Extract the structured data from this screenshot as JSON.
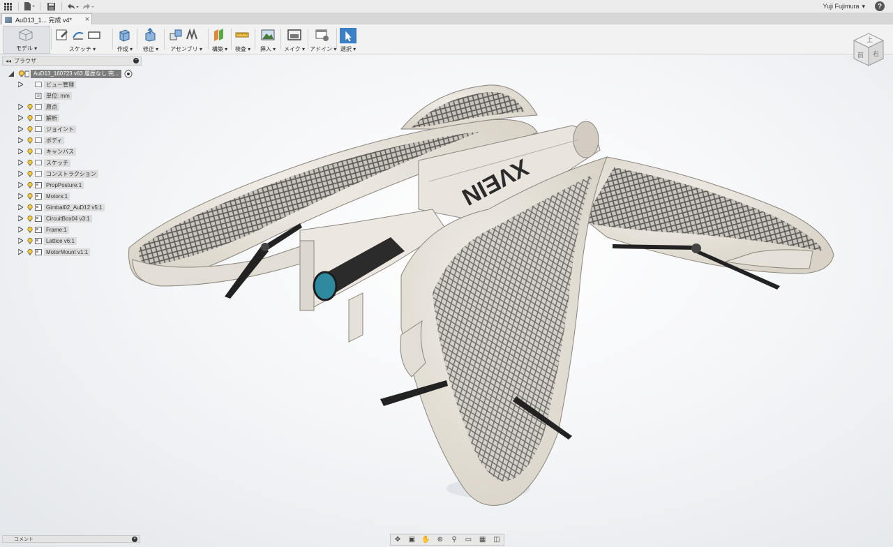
{
  "topbar": {
    "user_name": "Yuji Fujimura",
    "user_caret": "▾",
    "help_label": "?"
  },
  "tab": {
    "title": "AuD13_1...  完成 v4*",
    "close": "×"
  },
  "ribbon": {
    "workspace_label": "モデル ▾",
    "groups": [
      {
        "label": "スケッチ ▾"
      },
      {
        "label": "作成 ▾"
      },
      {
        "label": "修正 ▾"
      },
      {
        "label": "アセンブリ ▾"
      },
      {
        "label": "構築 ▾"
      },
      {
        "label": "検査 ▾"
      },
      {
        "label": "挿入 ▾"
      },
      {
        "label": "メイク ▾"
      },
      {
        "label": "アドイン ▾"
      },
      {
        "label": "選択 ▾"
      }
    ]
  },
  "browser": {
    "title": "ブラウザ",
    "collapse": "◂◂",
    "minus": "−",
    "root_label": "AuD13_160723 v63 履歴なし 完...",
    "items": [
      {
        "label": "ビュー管理"
      },
      {
        "label": "単位: mm"
      },
      {
        "label": "原点"
      },
      {
        "label": "解析"
      },
      {
        "label": "ジョイント"
      },
      {
        "label": "ボディ"
      },
      {
        "label": "キャンバス"
      },
      {
        "label": "スケッチ"
      },
      {
        "label": "コンストラクション"
      },
      {
        "label": "PropPosture:1"
      },
      {
        "label": "Motors:1"
      },
      {
        "label": "Gimbal02_AuD12 v5:1"
      },
      {
        "label": "CircuitBox04 v3:1"
      },
      {
        "label": "Frame:1"
      },
      {
        "label": "Lattice v6:1"
      },
      {
        "label": "MotorMount v1:1"
      }
    ]
  },
  "viewcube": {
    "top_face": "上",
    "front_face": "前",
    "right_face": "右"
  },
  "model": {
    "logo_text": "XVEIN"
  },
  "comments": {
    "title": "コメント",
    "plus": "+"
  },
  "colors": {
    "shell": "#e7e2d8",
    "lattice_dark": "#6f6b68",
    "lens": "#2f8aa0",
    "accent": "#3b7fc4"
  }
}
